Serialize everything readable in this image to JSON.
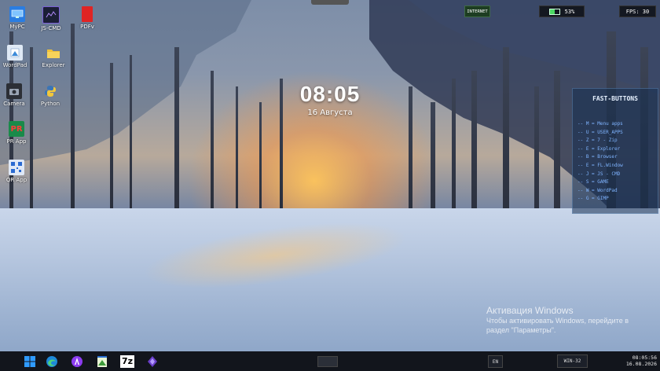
{
  "desktop_icons": [
    {
      "label": "MyPC"
    },
    {
      "label": "JS-CMD"
    },
    {
      "label": "PDFv"
    },
    {
      "label": "WordPad"
    },
    {
      "label": "Explorer"
    },
    {
      "label": "Camera"
    },
    {
      "label": "Python"
    },
    {
      "label": "PR App"
    },
    {
      "label": "QR App"
    }
  ],
  "clock": {
    "time": "08:05",
    "date": "16 Августа"
  },
  "top_bar": {
    "internet": "INTERNET",
    "battery": "53%",
    "fps": "FPS: 30"
  },
  "fast_buttons": {
    "title": "FAST-BUTTONS",
    "items": [
      "-- M = Menu apps",
      "-- U = USER_APPS",
      "-- Z = 7 - Zip",
      "-- E = Explorer",
      "-- B = Browser",
      "-- E = FL.Window",
      "-- J = JS - CMD",
      "-- S = GAME",
      "-- W = WordPad",
      "-- G = GIMP"
    ]
  },
  "activation": {
    "heading": "Активация Windows",
    "line1": "Чтобы активировать Windows, перейдите в",
    "line2": "раздел \"Параметры\"."
  },
  "taskbar": {
    "lang": "EN",
    "win": "WIN-32",
    "time": "08:05:56",
    "date": "16.08.2026",
    "icons": [
      "windows-start-icon",
      "edge-icon",
      "alice-icon",
      "notepad-icon",
      "7zip-icon",
      "obsidian-icon"
    ]
  },
  "colors": {
    "fast_text": "#7fb4ff",
    "internet_bg": "#1d3d22",
    "battery_green": "#4cd964"
  }
}
